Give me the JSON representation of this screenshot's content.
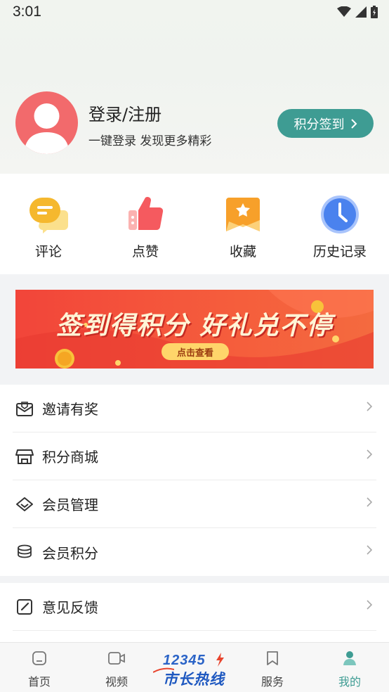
{
  "status_bar": {
    "time": "3:01"
  },
  "profile": {
    "login_title": "登录/注册",
    "login_subtitle": "一键登录 发现更多精彩",
    "signin_button": "积分签到"
  },
  "quick_actions": [
    {
      "label": "评论",
      "icon": "comment-icon",
      "color": "#f5b82e"
    },
    {
      "label": "点赞",
      "icon": "thumbs-up-icon",
      "color": "#f55a5f"
    },
    {
      "label": "收藏",
      "icon": "bookmark-star-icon",
      "color": "#f7a02a"
    },
    {
      "label": "历史记录",
      "icon": "clock-icon",
      "color": "#4a82ee"
    }
  ],
  "banner": {
    "title": "签到得积分 好礼兑不停",
    "button": "点击查看"
  },
  "menu_group_1": [
    {
      "label": "邀请有奖",
      "icon": "invite-envelope-icon"
    },
    {
      "label": "积分商城",
      "icon": "store-icon"
    },
    {
      "label": "会员管理",
      "icon": "diamond-icon"
    },
    {
      "label": "会员积分",
      "icon": "coins-stack-icon"
    }
  ],
  "menu_group_2": [
    {
      "label": "意见反馈",
      "icon": "edit-feedback-icon"
    }
  ],
  "tabbar": {
    "tabs": [
      {
        "label": "首页",
        "icon": "home-icon"
      },
      {
        "label": "视频",
        "icon": "video-icon"
      },
      {
        "label": "服务",
        "icon": "bookmark-icon"
      },
      {
        "label": "我的",
        "icon": "user-icon",
        "active": true
      }
    ],
    "hotline_number": "12345",
    "hotline_text": "市长热线"
  },
  "colors": {
    "accent": "#3e9c93",
    "avatar_bg": "#f26a6c"
  }
}
